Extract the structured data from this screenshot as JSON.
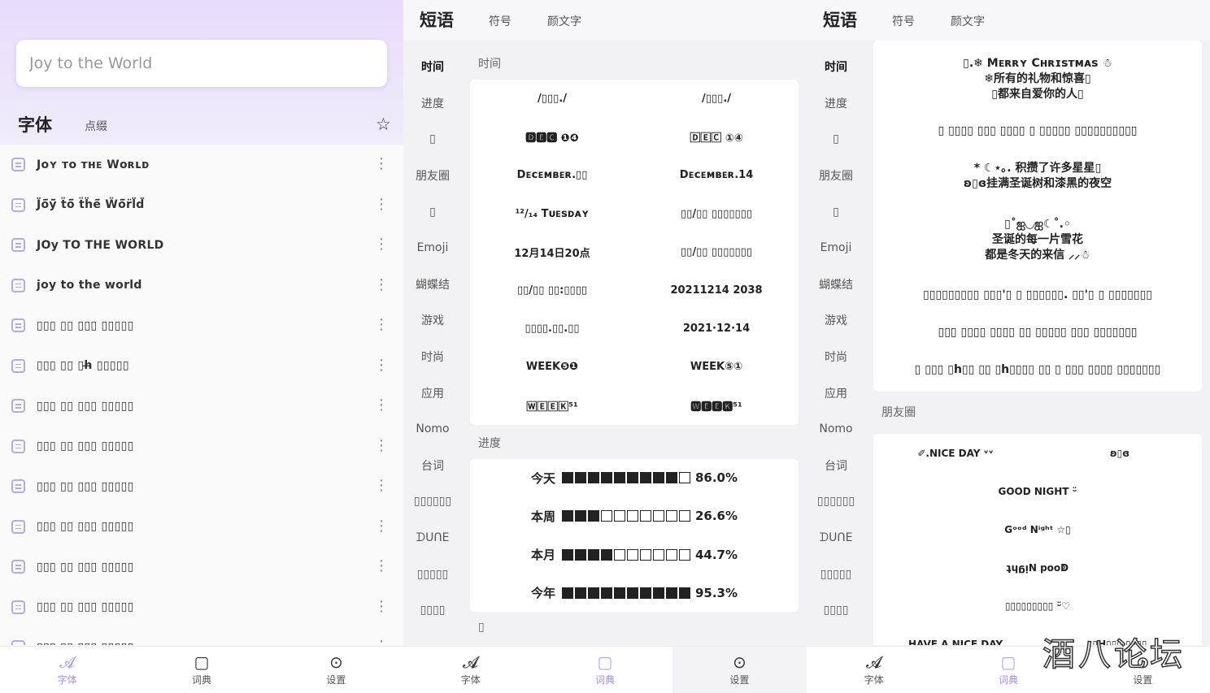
{
  "screen1": {
    "search_value": "Joy to the World",
    "tabs": [
      "字体",
      "点缀"
    ],
    "rows": [
      "Jᴏʏ ᴛᴏ ᴛʜᴇ Wᴏʀʟᴅ",
      "J̈ö̈ÿ̈ ẗö̈ ẗḧë̈ Ẅö̈r̈l̈d̈",
      "JOу TO THE WORLD",
      "joy to the world",
      "▯▯▯ ▯▯ ▯▯▯ ▯▯▯▯▯",
      "▯▯▯ ▯▯ ▯h̶ ▯▯▯▯▯",
      "▯▯▯ ▯▯ ▯▯▯ ▯▯▯▯▯",
      "▯▯▯ ▯▯ ▯▯▯ ▯▯▯▯▯",
      "▯▯▯ ▯▯ ▯▯▯ ▯▯▯▯▯",
      "▯▯▯ ▯▯ ▯▯▯ ▯▯▯▯▯",
      "▯▯▯ ▯▯ ▯▯▯ ▯▯▯▯▯",
      "▯▯▯ ▯▯ ▯▯▯ ▯▯▯▯▯",
      "▯▯▯ ▯▯ ▯▯▯ ▯▯▯▯▯"
    ]
  },
  "nav": {
    "font": "字体",
    "dict": "词典",
    "settings": "设置"
  },
  "phrase_tabs": [
    "短语",
    "符号",
    "颜文字"
  ],
  "sidebar": [
    "时间",
    "进度",
    "▯",
    "朋友圈",
    "▯",
    "Emoji",
    "蝴蝶结",
    "游戏",
    "时尚",
    "应用",
    "Nomo",
    "台词",
    "▯▯▯▯▯▯",
    "ᗪᑌᑎE",
    "▯▯▯▯▯",
    "▯▯▯▯"
  ],
  "screen2": {
    "section_time": "时间",
    "time_items": [
      "/▯▯▯./",
      "/▯▯▯./",
      "🅳🅴🅲 ❶❹",
      "🄳🄴🄲 ①④",
      "Dᴇᴄᴇᴍʙᴇʀ.▯▯",
      "Dᴇᴄᴇᴍʙᴇʀ.14",
      "¹²/₁₄ Tᴜᴇsᴅᴀʏ",
      "▯▯/▯▯ ▯▯▯▯▯▯▯",
      "12月14日20点",
      "▯▯/▯▯ ▯▯▯▯▯▯▯",
      "▯▯/▯▯ ▯▯:▯▯▯▯",
      "20211214 2038",
      "▯▯▯▯.▯▯.▯▯",
      "2021·12·14",
      "WEEK❺❶",
      "WEEK⑤①",
      "🅆🄴🄴🄺⁵¹",
      "🆆🅴🅴🅺⁵¹"
    ],
    "section_progress": "进度",
    "progress": [
      {
        "label": "今天",
        "filled": 9,
        "total": 10,
        "value": "86.0%"
      },
      {
        "label": "本周",
        "filled": 3,
        "total": 10,
        "value": "26.6%"
      },
      {
        "label": "本月",
        "filled": 4,
        "total": 10,
        "value": "44.7%"
      },
      {
        "label": "今年",
        "filled": 10,
        "total": 10,
        "value": "95.3%"
      }
    ],
    "section_next": "▯"
  },
  "screen3": {
    "messages": [
      "▯.❄ Mᴇʀʀʏ Cʜʀɪsᴛᴍᴀs ☃\n❄所有的礼物和惊喜▯\n▯都来自爱你的人▯",
      "▯ ▯▯▯▯ ▯▯▯ ▯▯▯▯ ▯ ▯▯▯▯▯ ▯▯▯▯▯▯▯▯▯▯",
      "* ☾⋆｡. 积攒了许多星星▯\nʚ▯ɞ挂满圣诞树和漆黑的夜空",
      "▯˚ஐ◡ஐ☾˚.◦\n圣诞的每一片雪花\n都是冬天的来信 ⸝⸝☃",
      "▯▯▯▯▯▯▯▯▯ ▯▯▯'▯ ▯ ▯▯▯▯▯▯. ▯▯'▯ ▯ ▯▯▯▯▯▯▯",
      "▯▯▯ ▯▯▯▯ ▯▯▯▯ ▯▯ ▯▯▯▯▯ ▯▯▯ ▯▯▯▯▯▯▯",
      "▯ ▯▯▯ ▯h▯▯ ▯▯ ▯h▯▯▯▯ ▯▯ ▯ ▯▯▯ ▯▯▯▯ ▯▯▯▯▯▯▯"
    ],
    "section_moments": "朋友圈",
    "moments": [
      "✐.NICE DAY ᵛᵛ",
      "ʚ▯ɞ",
      "GOOD NIGHT ᵕ̈",
      "Gᵒᵒᵈ Nⁱᵍʰᵗ ☆▯",
      "ʇɥᵷᴉN pooↁ",
      "▯▯▯▯▯▯▯▯▯ ᵕ̈♡",
      "HAVE A NICE DAY",
      "▯H▯▯▯ ▯▯▯▯"
    ],
    "watermark": "酒八论坛"
  }
}
